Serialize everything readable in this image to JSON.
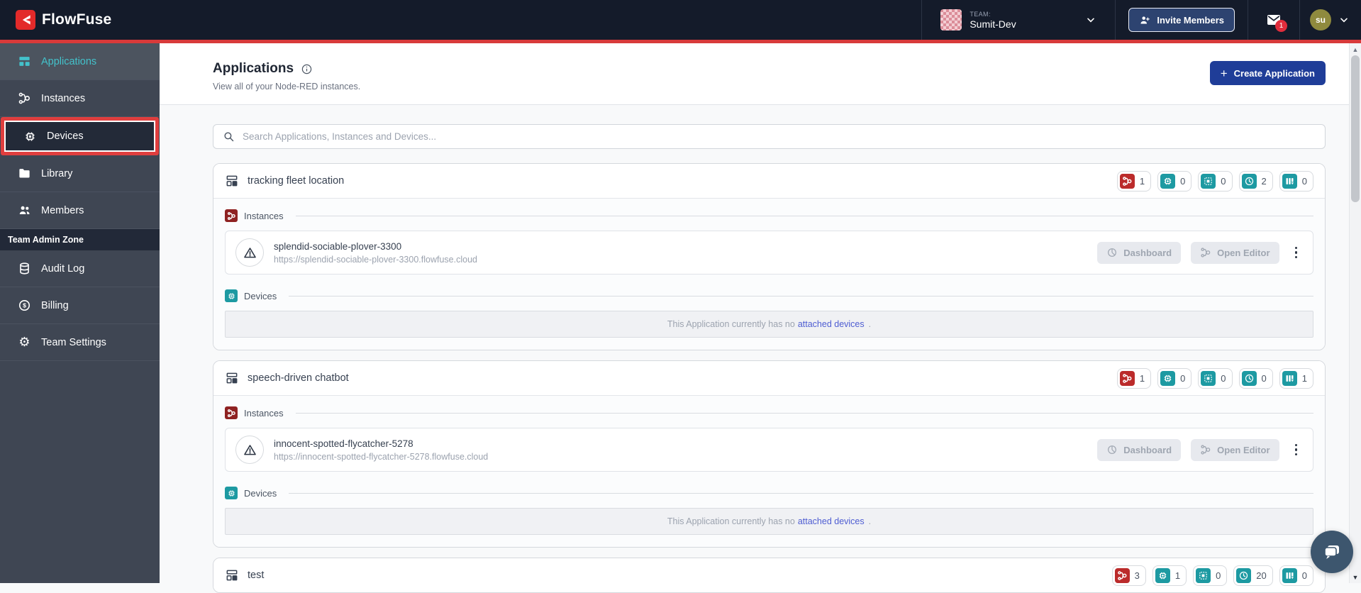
{
  "colors": {
    "header_bg": "#141b2a",
    "sidebar_bg": "#3f4653",
    "accent_teal": "#43c2cb",
    "badge_teal": "#1d9aa2",
    "badge_red": "#bb2b2b",
    "brand_red": "#e32a2a",
    "annotation_red": "#d83a3a",
    "create_button_blue": "#1f3d98",
    "invite_button_blue": "#2d4370",
    "link_indigo": "#4e5dd2"
  },
  "header": {
    "logo_text": "FlowFuse",
    "team_label": "TEAM:",
    "team_name": "Sumit-Dev",
    "invite_label": "Invite Members",
    "notification_count": "1",
    "avatar_initials": "su"
  },
  "sidebar": {
    "applications": "Applications",
    "instances": "Instances",
    "devices": "Devices",
    "library": "Library",
    "members": "Members",
    "admin_zone": "Team Admin Zone",
    "audit_log": "Audit Log",
    "billing": "Billing",
    "team_settings": "Team Settings"
  },
  "main": {
    "title": "Applications",
    "subtitle": "View all of your Node-RED instances.",
    "create_label": "Create Application",
    "create_plus": "+",
    "search_placeholder": "Search Applications, Instances and Devices...",
    "section_instances": "Instances",
    "section_devices": "Devices",
    "dashboard_label": "Dashboard",
    "open_editor_label": "Open Editor",
    "empty_prefix": "This Application currently has no",
    "empty_link": "attached devices",
    "empty_suffix": ".",
    "applications": [
      {
        "name": "tracking fleet location",
        "badges": {
          "instances": "1",
          "devices": "0",
          "device_groups": "0",
          "snapshots": "2",
          "pipelines": "0"
        },
        "instance": {
          "name": "splendid-sociable-plover-3300",
          "url": "https://splendid-sociable-plover-3300.flowfuse.cloud"
        }
      },
      {
        "name": "speech-driven chatbot",
        "badges": {
          "instances": "1",
          "devices": "0",
          "device_groups": "0",
          "snapshots": "0",
          "pipelines": "1"
        },
        "instance": {
          "name": "innocent-spotted-flycatcher-5278",
          "url": "https://innocent-spotted-flycatcher-5278.flowfuse.cloud"
        }
      },
      {
        "name": "test",
        "badges": {
          "instances": "3",
          "devices": "1",
          "device_groups": "0",
          "snapshots": "20",
          "pipelines": "0"
        }
      }
    ]
  }
}
